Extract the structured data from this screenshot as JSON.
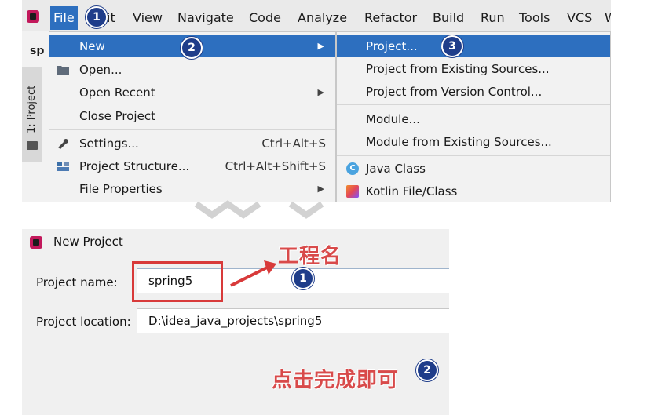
{
  "ide": {
    "menubar": {
      "items": [
        "File",
        "Edit",
        "View",
        "Navigate",
        "Code",
        "Analyze",
        "Refactor",
        "Build",
        "Run",
        "Tools",
        "VCS",
        "W"
      ],
      "visible": {
        "file": "File",
        "edit_tail": "it",
        "view": "View",
        "navigate": "Navigate",
        "code": "Code",
        "analyze": "Analyze",
        "refactor": "Refactor",
        "build": "Build",
        "run": "Run",
        "tools": "Tools",
        "vcs": "VCS",
        "more": "W"
      }
    },
    "tab_stub": "sp",
    "side_panel_label": "1: Project",
    "file_menu": [
      {
        "label": "New",
        "shortcut": "",
        "submenu": true,
        "selected": true,
        "icon": ""
      },
      {
        "label": "Open...",
        "shortcut": "",
        "submenu": false,
        "selected": false,
        "icon": "folder-open-icon"
      },
      {
        "label": "Open Recent",
        "shortcut": "",
        "submenu": true,
        "selected": false,
        "icon": ""
      },
      {
        "label": "Close Project",
        "shortcut": "",
        "submenu": false,
        "selected": false,
        "icon": ""
      },
      {
        "label": "Settings...",
        "shortcut": "Ctrl+Alt+S",
        "submenu": false,
        "selected": false,
        "icon": "wrench-icon"
      },
      {
        "label": "Project Structure...",
        "shortcut": "Ctrl+Alt+Shift+S",
        "submenu": false,
        "selected": false,
        "icon": "project-structure-icon"
      },
      {
        "label": "File Properties",
        "shortcut": "",
        "submenu": true,
        "selected": false,
        "icon": ""
      }
    ],
    "new_submenu": [
      {
        "label": "Project...",
        "selected": true,
        "icon": ""
      },
      {
        "label": "Project from Existing Sources...",
        "selected": false,
        "icon": ""
      },
      {
        "label": "Project from Version Control...",
        "selected": false,
        "icon": ""
      },
      {
        "label": "Module...",
        "selected": false,
        "icon": ""
      },
      {
        "label": "Module from Existing Sources...",
        "selected": false,
        "icon": ""
      },
      {
        "label": "Java Class",
        "selected": false,
        "icon": "java-class-icon"
      },
      {
        "label": "Kotlin File/Class",
        "selected": false,
        "icon": "kotlin-icon"
      }
    ],
    "java_icon_letter": "C",
    "badges": [
      "1",
      "2",
      "3"
    ]
  },
  "dialog": {
    "title": "New Project",
    "project_name_label": "Project name:",
    "project_name_value": "spring5",
    "project_location_label": "Project location:",
    "project_location_value": "D:\\idea_java_projects\\spring5",
    "annotation_name": "工程名",
    "annotation_finish": "点击完成即可",
    "badges": [
      "1",
      "2"
    ]
  },
  "colors": {
    "selection": "#2d6fbf",
    "badge": "#1f3d8a",
    "annotation_red": "#d84a4a",
    "highlight_box": "#d83a3a"
  }
}
